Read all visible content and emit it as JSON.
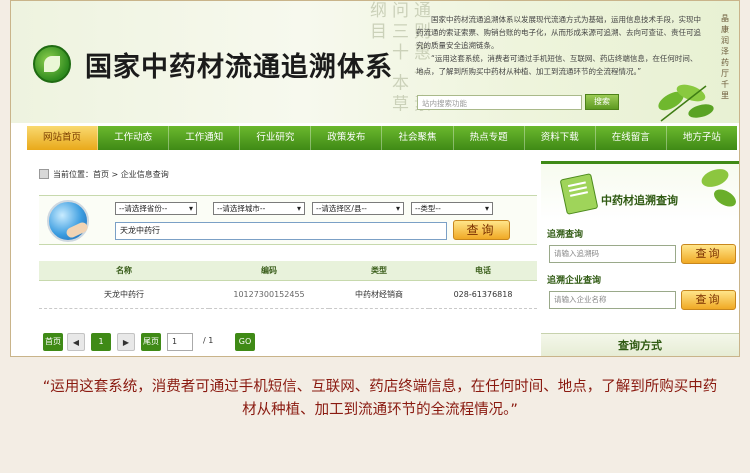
{
  "header": {
    "site_title": "国家中药材流通追溯体系",
    "calligraphy": "通则惠一 素问三十 本草纲目",
    "intro_1": "国家中药材流通追溯体系以发展现代流通方式为基础，运用信息技术手段，实现中药流通的索证索票、购销台账的电子化，从而形成来源可追溯、去向可查证、责任可追究的质量安全追溯链条。",
    "intro_2": "“运用这套系统，消费者可通过手机短信、互联网、药店终端信息，在任何时间、地点，了解到所购买中药材从种植、加工到流通环节的全流程情况。”",
    "search_placeholder": "站内搜索功能",
    "search_button": "搜索",
    "vertical_brand": "晶康润泽 药厅千里"
  },
  "nav": {
    "items": [
      "网站首页",
      "工作动态",
      "工作通知",
      "行业研究",
      "政策发布",
      "社会聚焦",
      "热点专题",
      "资料下载",
      "在线留言",
      "地方子站"
    ]
  },
  "breadcrumb": {
    "prefix": "当前位置：",
    "home": "首页",
    "sep": " > ",
    "current": "企业信息查询"
  },
  "query": {
    "province": "--请选择省份--",
    "city": "--请选择城市--",
    "district": "--请选择区/县--",
    "type": "--类型--",
    "keyword": "天龙中药行",
    "button": "查询"
  },
  "table": {
    "headers": [
      "名称",
      "编码",
      "类型",
      "电话"
    ],
    "rows": [
      [
        "天龙中药行",
        "10127300152455",
        "中药材经销商",
        "028-61376818"
      ]
    ]
  },
  "pager": {
    "first": "首页",
    "prev": "◀",
    "current": "1",
    "next": "▶",
    "last": "尾页",
    "input": "1",
    "total": "/ 1",
    "go": "GO"
  },
  "right": {
    "title": "中药材追溯查询",
    "trace_label": "追溯查询",
    "trace_placeholder": "请输入追溯码",
    "trace_button": "查询",
    "company_label": "追溯企业查询",
    "company_placeholder": "请输入企业名称",
    "company_button": "查询",
    "method": "查询方式"
  },
  "quote": "“运用这套系统，消费者可通过手机短信、互联网、药店终端信息，在任何时间、地点，了解到所购买中药材从种植、加工到流通环节的全流程情况。”"
}
